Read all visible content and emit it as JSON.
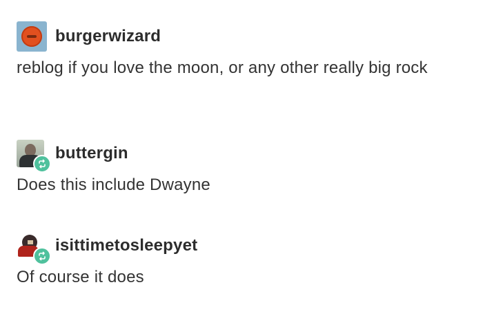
{
  "posts": [
    {
      "username": "burgerwizard",
      "avatar": "orange-burger-avatar",
      "text": "reblog if you love the moon, or any other really big rock",
      "reblog": false
    },
    {
      "username": "buttergin",
      "avatar": "man-photo-avatar",
      "text": "Does this include Dwayne",
      "reblog": true
    },
    {
      "username": "isittimetosleepyet",
      "avatar": "character-avatar",
      "text": "Of course it does",
      "reblog": true
    }
  ],
  "colors": {
    "reblog_badge": "#4fc19d",
    "text": "#333333",
    "username": "#2c2c2c",
    "background": "#ffffff"
  },
  "icons": {
    "reblog": "reblog-icon"
  }
}
